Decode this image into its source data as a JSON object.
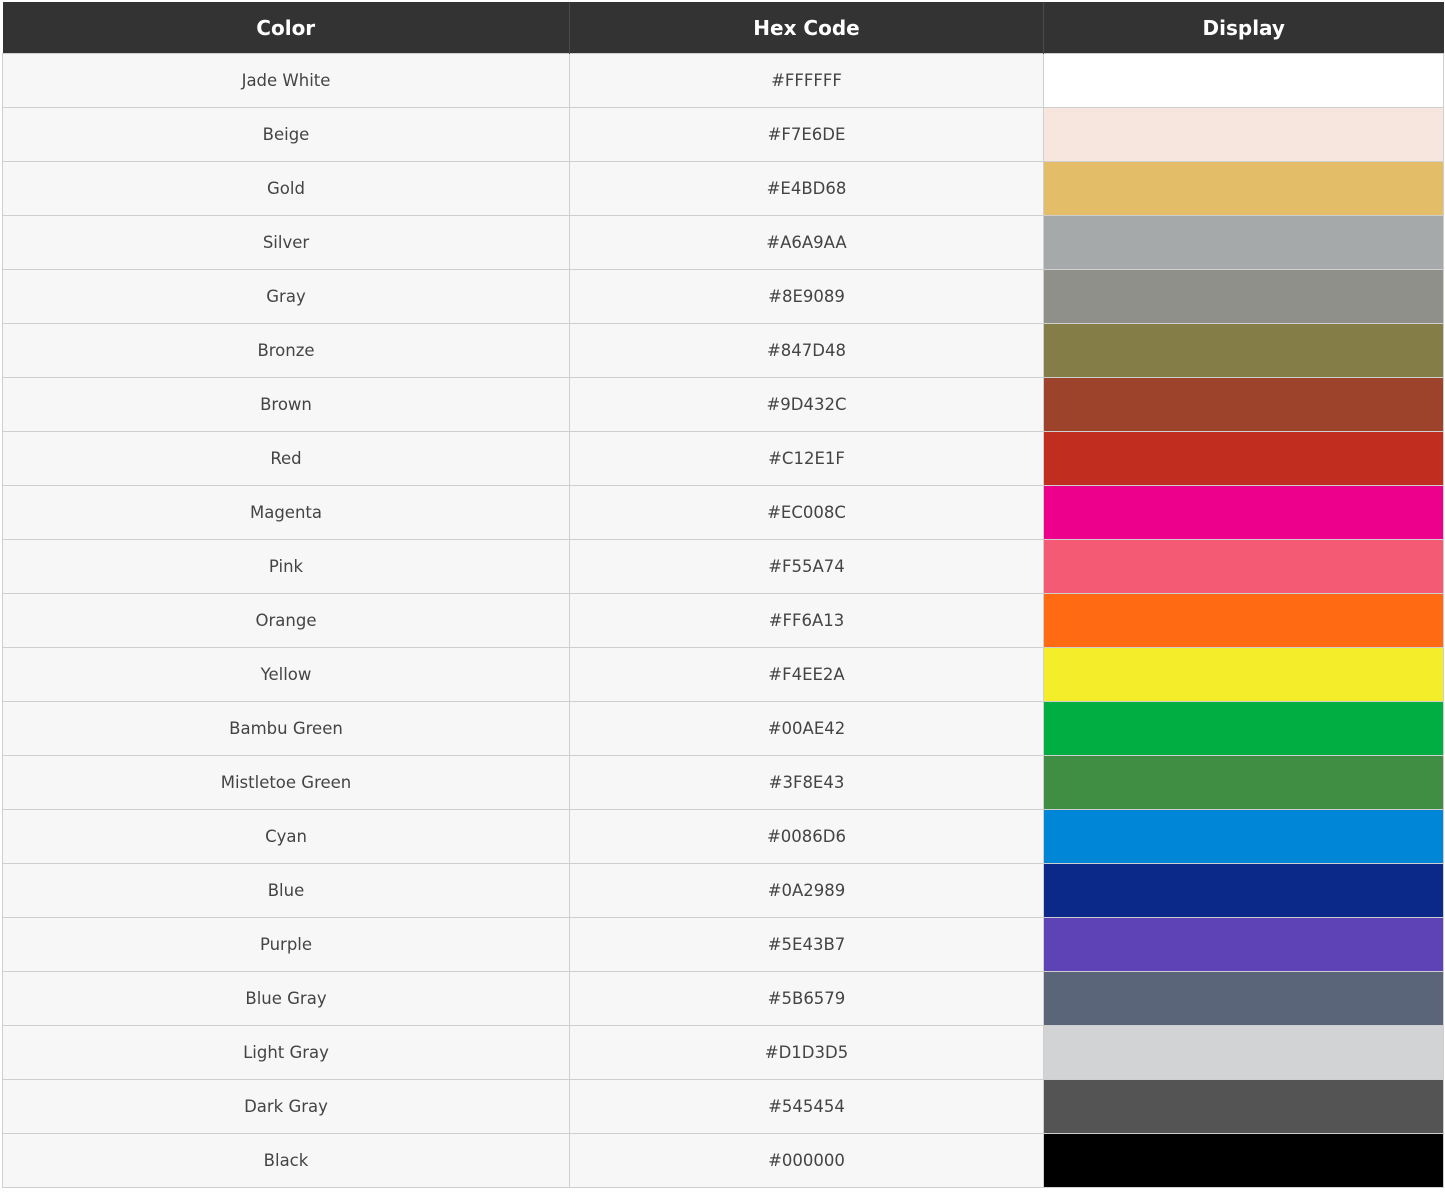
{
  "table": {
    "headers": [
      "Color",
      "Hex Code",
      "Display"
    ],
    "rows": [
      {
        "name": "Jade White",
        "hex": "#FFFFFF",
        "swatch": "#FFFFFF"
      },
      {
        "name": "Beige",
        "hex": "#F7E6DE",
        "swatch": "#F7E6DE"
      },
      {
        "name": "Gold",
        "hex": "#E4BD68",
        "swatch": "#E4BD68"
      },
      {
        "name": "Silver",
        "hex": "#A6A9AA",
        "swatch": "#A6A9AA"
      },
      {
        "name": "Gray",
        "hex": "#8E9089",
        "swatch": "#8E9089"
      },
      {
        "name": "Bronze",
        "hex": "#847D48",
        "swatch": "#847D48"
      },
      {
        "name": "Brown",
        "hex": "#9D432C",
        "swatch": "#9D432C"
      },
      {
        "name": "Red",
        "hex": "#C12E1F",
        "swatch": "#C12E1F"
      },
      {
        "name": "Magenta",
        "hex": "#EC008C",
        "swatch": "#EC008C"
      },
      {
        "name": "Pink",
        "hex": "#F55A74",
        "swatch": "#F55A74"
      },
      {
        "name": "Orange",
        "hex": "#FF6A13",
        "swatch": "#FF6A13"
      },
      {
        "name": "Yellow",
        "hex": "#F4EE2A",
        "swatch": "#F4EE2A"
      },
      {
        "name": "Bambu Green",
        "hex": "#00AE42",
        "swatch": "#00AE42"
      },
      {
        "name": "Mistletoe Green",
        "hex": "#3F8E43",
        "swatch": "#3F8E43"
      },
      {
        "name": "Cyan",
        "hex": "#0086D6",
        "swatch": "#0086D6"
      },
      {
        "name": "Blue",
        "hex": "#0A2989",
        "swatch": "#0A2989"
      },
      {
        "name": "Purple",
        "hex": "#5E43B7",
        "swatch": "#5E43B7"
      },
      {
        "name": "Blue Gray",
        "hex": "#5B6579",
        "swatch": "#5B6579"
      },
      {
        "name": "Light Gray",
        "hex": "#D1D3D5",
        "swatch": "#D1D3D5"
      },
      {
        "name": "Dark Gray",
        "hex": "#545454",
        "swatch": "#545454"
      },
      {
        "name": "Black",
        "hex": "#000000",
        "swatch": "#000000"
      }
    ]
  }
}
